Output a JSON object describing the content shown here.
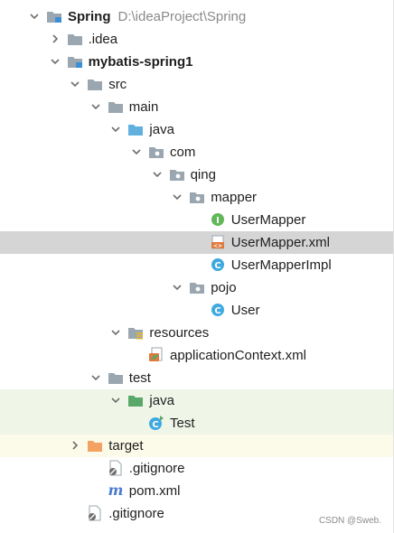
{
  "tree": [
    {
      "label": "Spring",
      "path": "D:\\ideaProject\\Spring",
      "arrow": "down",
      "icon": "module-folder",
      "level": 0,
      "bold": true
    },
    {
      "label": ".idea",
      "arrow": "right",
      "icon": "folder",
      "level": 1
    },
    {
      "label": "mybatis-spring1",
      "arrow": "down",
      "icon": "module-folder",
      "level": 1,
      "bold": true
    },
    {
      "label": "src",
      "arrow": "down",
      "icon": "folder",
      "level": 2
    },
    {
      "label": "main",
      "arrow": "down",
      "icon": "folder",
      "level": 3
    },
    {
      "label": "java",
      "arrow": "down",
      "icon": "source-folder",
      "level": 4
    },
    {
      "label": "com",
      "arrow": "down",
      "icon": "package",
      "level": 5
    },
    {
      "label": "qing",
      "arrow": "down",
      "icon": "package",
      "level": 6
    },
    {
      "label": "mapper",
      "arrow": "down",
      "icon": "package",
      "level": 7
    },
    {
      "label": "UserMapper",
      "arrow": "none",
      "icon": "interface",
      "level": 8
    },
    {
      "label": "UserMapper.xml",
      "arrow": "none",
      "icon": "xml",
      "level": 8,
      "selected": true
    },
    {
      "label": "UserMapperImpl",
      "arrow": "none",
      "icon": "class",
      "level": 8
    },
    {
      "label": "pojo",
      "arrow": "down",
      "icon": "package",
      "level": 7
    },
    {
      "label": "User",
      "arrow": "none",
      "icon": "class",
      "level": 8
    },
    {
      "label": "resources",
      "arrow": "down",
      "icon": "resources-folder",
      "level": 4
    },
    {
      "label": "applicationContext.xml",
      "arrow": "none",
      "icon": "spring-xml",
      "level": 5
    },
    {
      "label": "test",
      "arrow": "down",
      "icon": "folder",
      "level": 3
    },
    {
      "label": "java",
      "arrow": "down",
      "icon": "test-folder",
      "level": 4,
      "highlight": "test"
    },
    {
      "label": "Test",
      "arrow": "none",
      "icon": "class-runnable",
      "level": 5,
      "highlight": "test"
    },
    {
      "label": "target",
      "arrow": "right",
      "icon": "excluded-folder",
      "level": 2,
      "highlight": "excluded"
    },
    {
      "label": ".gitignore",
      "arrow": "none",
      "icon": "gitignore-file",
      "level": 3
    },
    {
      "label": "pom.xml",
      "arrow": "none",
      "icon": "maven",
      "level": 3
    },
    {
      "label": ".gitignore",
      "arrow": "none",
      "icon": "gitignore-file",
      "level": 2
    }
  ],
  "colors": {
    "folder": "#9aa7b0",
    "source": "#62b0de",
    "test": "#59a869",
    "excluded": "#f4a261",
    "interface": "#62b858",
    "class": "#40a9e0",
    "xml": "#e07a3c",
    "maven": "#4a7bd0",
    "selected": "#d5d5d5"
  },
  "watermark": "CSDN @Sweb."
}
